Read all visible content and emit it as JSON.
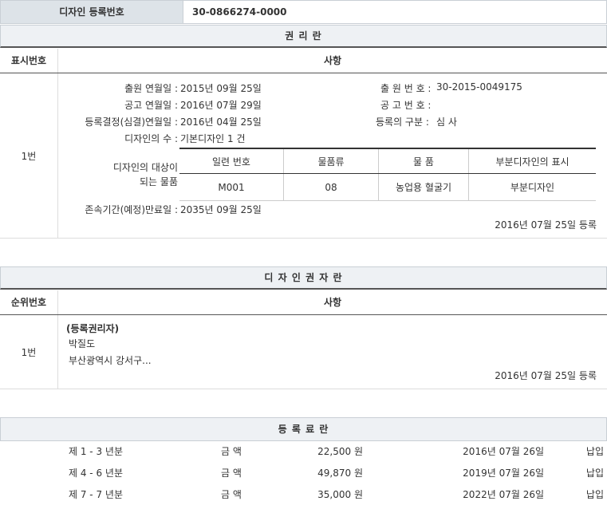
{
  "reg": {
    "label": "디자인 등록번호",
    "value": "30-0866274-0000"
  },
  "rights": {
    "title": "권 리 란",
    "col_no": "표시번호",
    "col_item": "사항",
    "row_no": "1번",
    "app_date_label": "출원 연월일 :",
    "app_date": "2015년 09월 25일",
    "app_no_label": "출 원 번 호 :",
    "app_no": "30-2015-0049175",
    "pub_date_label": "공고 연월일 :",
    "pub_date": "2016년 07월 29일",
    "pub_no_label": "공 고 번 호 :",
    "pub_no": "",
    "decision_date_label": "등록결정(심결)연월일 :",
    "decision_date": "2016년 04월 25일",
    "reg_type_label": "등록의 구분 :",
    "reg_type": "심 사",
    "count_label": "디자인의 수 :",
    "count": "기본디자인 1 건",
    "goods_label_1": "디자인의 대상이",
    "goods_label_2": "되는 물품",
    "goods_headers": [
      "일련 번호",
      "물품류",
      "물 품",
      "부분디자인의 표시"
    ],
    "goods_row": [
      "M001",
      "08",
      "농업용 혈굴기",
      "부분디자인"
    ],
    "expiry_label": "존속기간(예정)만료일 :",
    "expiry": "2035년 09월 25일",
    "reg_note": "2016년 07월 25일 등록"
  },
  "holder": {
    "title": "디 자 인 권 자 란",
    "col_no": "순위번호",
    "col_item": "사항",
    "row_no": "1번",
    "type": "(등록권리자)",
    "name": "박질도",
    "address": "부산광역시 강서구...",
    "reg_note": "2016년 07월 25일 등록"
  },
  "fees": {
    "title": "등 록 료 란",
    "rows": [
      {
        "period": "제 1 - 3 년분",
        "amount_label": "금 액",
        "amount": "22,500 원",
        "date": "2016년 07월 26일",
        "status": "납입"
      },
      {
        "period": "제 4 - 6 년분",
        "amount_label": "금 액",
        "amount": "49,870 원",
        "date": "2019년 07월 26일",
        "status": "납입"
      },
      {
        "period": "제 7 - 7 년분",
        "amount_label": "금 액",
        "amount": "35,000 원",
        "date": "2022년 07월 26일",
        "status": "납입"
      }
    ]
  }
}
